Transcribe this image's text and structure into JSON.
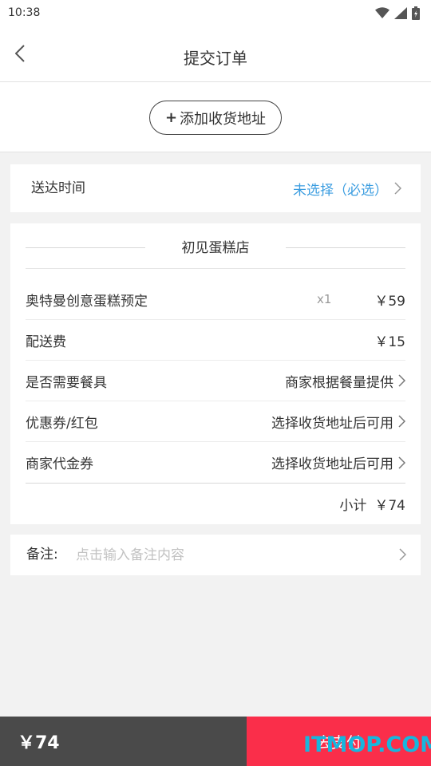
{
  "status_bar": {
    "time": "10:38"
  },
  "nav": {
    "title": "提交订单"
  },
  "address": {
    "add_label": "添加收货地址",
    "plus": "+"
  },
  "delivery": {
    "label": "送达时间",
    "value": "未选择（必选）"
  },
  "order": {
    "shop_name": "初见蛋糕店",
    "item": {
      "name": "奥特曼创意蛋糕预定",
      "qty": "x1",
      "price": "￥59"
    },
    "delivery_fee": {
      "label": "配送费",
      "value": "￥15"
    },
    "tableware": {
      "label": "是否需要餐具",
      "value": "商家根据餐量提供"
    },
    "coupon": {
      "label": "优惠券/红包",
      "value": "选择收货地址后可用"
    },
    "voucher": {
      "label": "商家代金券",
      "value": "选择收货地址后可用"
    },
    "subtotal": {
      "label": "小计",
      "value": "￥74"
    }
  },
  "remark": {
    "label": "备注:",
    "placeholder": "点击输入备注内容",
    "value": ""
  },
  "footer": {
    "total": "￥74",
    "pay_label": "去支付"
  },
  "watermark": "ITMOP.COM",
  "colors": {
    "accent_blue": "#3b9de0",
    "pay_red": "#fa2e4a",
    "footer_dark": "#4a4a4a",
    "watermark": "#17b6dd"
  },
  "icons": [
    "back-arrow-icon",
    "wifi-icon",
    "signal-icon",
    "battery-icon",
    "chevron-right-icon"
  ]
}
